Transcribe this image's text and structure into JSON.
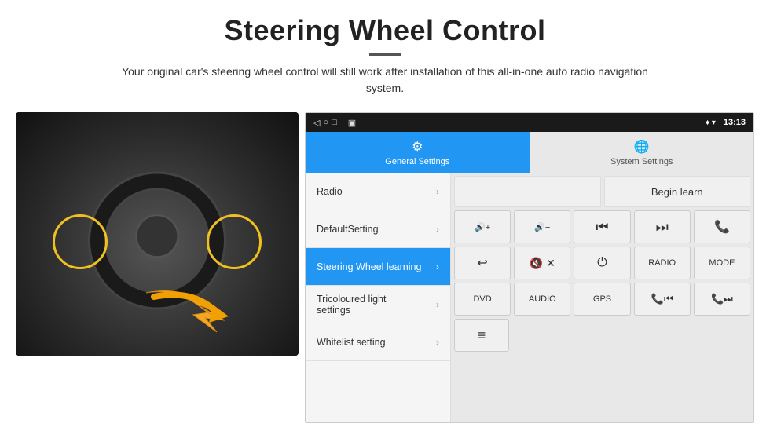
{
  "header": {
    "title": "Steering Wheel Control",
    "divider": true,
    "subtitle": "Your original car's steering wheel control will still work after installation of this all-in-one auto radio navigation system."
  },
  "status_bar": {
    "nav_icons": [
      "◁",
      "○",
      "□"
    ],
    "media_icon": "▣",
    "right": {
      "signal": "▾ ▾",
      "time": "13:13"
    }
  },
  "tabs": [
    {
      "label": "General Settings",
      "icon": "⚙",
      "active": true
    },
    {
      "label": "System Settings",
      "icon": "🌐",
      "active": false
    }
  ],
  "menu_items": [
    {
      "label": "Radio",
      "active": false
    },
    {
      "label": "DefaultSetting",
      "active": false
    },
    {
      "label": "Steering Wheel learning",
      "active": true
    },
    {
      "label": "Tricoloured light settings",
      "active": false
    },
    {
      "label": "Whitelist setting",
      "active": false
    }
  ],
  "controls": {
    "begin_learn": "Begin learn",
    "row1": [
      {
        "label": "🔊+",
        "type": "icon"
      },
      {
        "label": "🔊−",
        "type": "icon"
      },
      {
        "label": "⏮",
        "type": "icon"
      },
      {
        "label": "⏭",
        "type": "icon"
      },
      {
        "label": "📞",
        "type": "icon"
      }
    ],
    "row2": [
      {
        "label": "↩",
        "type": "icon"
      },
      {
        "label": "🔇",
        "type": "icon"
      },
      {
        "label": "⏻",
        "type": "icon"
      },
      {
        "label": "RADIO",
        "type": "text"
      },
      {
        "label": "MODE",
        "type": "text"
      }
    ],
    "row3": [
      {
        "label": "DVD",
        "type": "text"
      },
      {
        "label": "AUDIO",
        "type": "text"
      },
      {
        "label": "GPS",
        "type": "text"
      },
      {
        "label": "📞⏮",
        "type": "icon"
      },
      {
        "label": "📞⏭",
        "type": "icon"
      }
    ],
    "row4": [
      {
        "label": "≡",
        "type": "icon"
      }
    ]
  }
}
